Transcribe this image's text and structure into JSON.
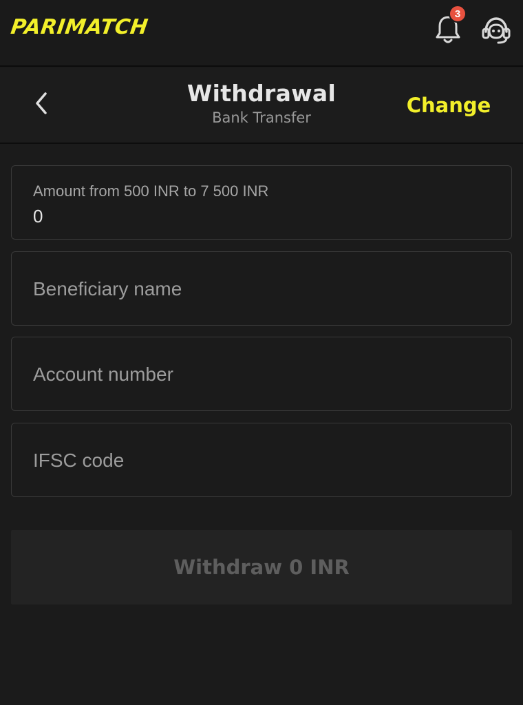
{
  "app": {
    "brand": "PARIMATCH",
    "notifications_count": "3",
    "accent_color": "#f2ef2a"
  },
  "header": {
    "title": "Withdrawal",
    "subtitle": "Bank Transfer",
    "change_label": "Change",
    "icons": [
      "chevron-left-icon",
      "bell-icon",
      "headset-icon"
    ]
  },
  "form": {
    "amount_label": "Amount from 500 INR to 7 500 INR",
    "amount_value": "0",
    "beneficiary_placeholder": "Beneficiary name",
    "account_placeholder": "Account number",
    "ifsc_placeholder": "IFSC code"
  },
  "actions": {
    "withdraw_label": "Withdraw 0 INR"
  }
}
